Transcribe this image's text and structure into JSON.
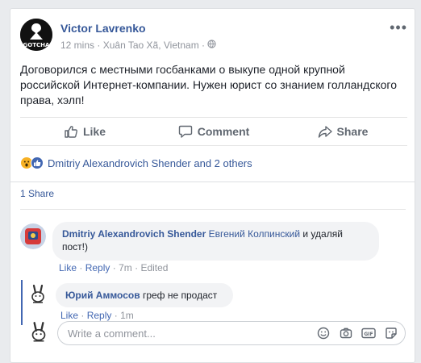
{
  "post": {
    "author": "Victor Lavrenko",
    "time": "12 mins",
    "location": "Xuân Tao Xã, Vietnam",
    "avatar_text": "GOTCHA",
    "text": "Договорился с местными госбанками о выкупе одной крупной российской Интернет-компании. Нужен юрист со знанием голландского права, хэлп!"
  },
  "actions": {
    "like": "Like",
    "comment": "Comment",
    "share": "Share"
  },
  "reactions": {
    "text": "Dmitriy Alexandrovich Shender and 2 others"
  },
  "shares": "1 Share",
  "comments": [
    {
      "name": "Dmitriy Alexandrovich Shender",
      "mention": "Евгений Колпинский",
      "text": " и удаляй пост!)",
      "like": "Like",
      "reply": "Reply",
      "time": "7m",
      "edited": "Edited"
    },
    {
      "name": "Юрий Аммосов",
      "text": " греф не продаст",
      "like": "Like",
      "reply": "Reply",
      "time": "1m"
    }
  ],
  "composer": {
    "placeholder": "Write a comment..."
  },
  "colors": {
    "link": "#365899",
    "accent": "#4267b2",
    "muted": "#90949c"
  },
  "icons": [
    "ellipsis-icon",
    "globe-icon",
    "like-icon",
    "comment-icon",
    "share-icon",
    "wow-reaction-icon",
    "like-reaction-icon",
    "emoji-icon",
    "camera-icon",
    "gif-icon",
    "sticker-icon"
  ]
}
